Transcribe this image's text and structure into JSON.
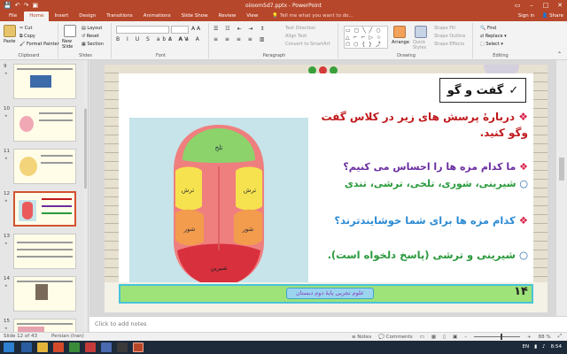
{
  "titlebar": {
    "title": "oiioom5d7.pptx - PowerPoint",
    "qat_icons": [
      "save-icon",
      "undo-icon",
      "redo-icon",
      "present-icon"
    ]
  },
  "tabs": {
    "file": "File",
    "items": [
      "Home",
      "Insert",
      "Design",
      "Transitions",
      "Animations",
      "Slide Show",
      "Review",
      "View"
    ],
    "active": "Home",
    "tell_me": "Tell me what you want to do...",
    "sign_in": "Sign in",
    "share": "Share"
  },
  "ribbon": {
    "clipboard": {
      "paste": "Paste",
      "cut": "Cut",
      "copy": "Copy",
      "format_painter": "Format Painter",
      "label": "Clipboard"
    },
    "slides": {
      "new_slide": "New Slide",
      "layout": "Layout",
      "reset": "Reset",
      "section": "Section",
      "label": "Slides"
    },
    "font": {
      "label": "Font",
      "format_row1": "B I U S abc AV",
      "format_row2": "A Aa A"
    },
    "paragraph": {
      "label": "Paragraph",
      "text_direction": "Text Direction",
      "align_text": "Align Text",
      "smartart": "Convert to SmartArt"
    },
    "drawing": {
      "label": "Drawing",
      "arrange": "Arrange",
      "quick_styles": "Quick Styles",
      "shape_fill": "Shape Fill",
      "shape_outline": "Shape Outline",
      "shape_effects": "Shape Effects",
      "shapes": "▭ ▢ ╲ ╱ ○ △ ⌐ ⌐ ▷ ☆ ⬠ ⬡ { } ⤴ ⇨"
    },
    "editing": {
      "label": "Editing",
      "find": "Find",
      "replace": "Replace",
      "select": "Select"
    }
  },
  "slide_panel": {
    "slides": [
      {
        "num": "9"
      },
      {
        "num": "10"
      },
      {
        "num": "11"
      },
      {
        "num": "12",
        "selected": true
      },
      {
        "num": "13"
      },
      {
        "num": "14"
      },
      {
        "num": "15"
      }
    ]
  },
  "slide": {
    "topic": "گفت و گو",
    "check_icon": "✓",
    "q1": "دربارهٔ پرسش های زیر در کلاس گفت وگو کنید.",
    "q2": "ما کدام مزه ها را احساس می کنیم؟",
    "a2": "شیرینی، شوری، تلخی، ترشی، تندی",
    "q3": "کدام مزه ها برای شما خوشایندترند؟",
    "a3": "شیرینی و ترشی (پاسخ دلخواه است).",
    "bullet_diamond": "❖",
    "bullet_circle": "○",
    "footer_label": "علوم تجربی پایهٔ دوم دبستان",
    "page_number": "۱۴",
    "tongue_labels": {
      "tip": "شیرین",
      "left_front": "شور",
      "right_front": "شور",
      "left_back": "ترش",
      "right_back": "ترش",
      "back": "تلخ"
    }
  },
  "notes": {
    "placeholder": "Click to add notes"
  },
  "status": {
    "slide_info": "Slide 12 of 43",
    "language": "Persian (Iran)",
    "notes": "Notes",
    "comments": "Comments",
    "zoom": "88 %"
  },
  "taskbar": {
    "time": "8:54",
    "lang": "EN"
  },
  "colors": {
    "accent": "#b7472a",
    "slide_bg": "#ffffff",
    "green_bar": "#9ee27a"
  }
}
